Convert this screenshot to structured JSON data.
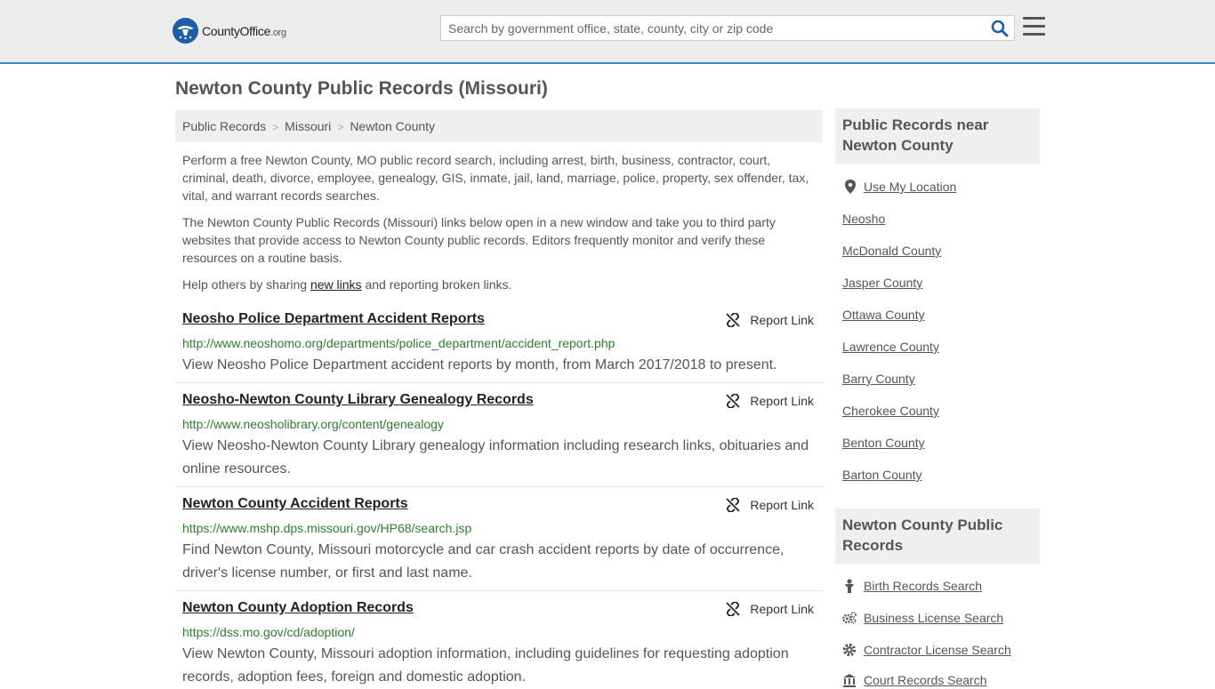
{
  "header": {
    "logo_text": "CountyOffice",
    "logo_suffix": ".org",
    "search_placeholder": "Search by government office, state, county, city or zip code"
  },
  "page_title": "Newton County Public Records (Missouri)",
  "breadcrumb": [
    "Public Records",
    "Missouri",
    "Newton County"
  ],
  "intro": {
    "p1": "Perform a free Newton County, MO public record search, including arrest, birth, business, contractor, court, criminal, death, divorce, employee, genealogy, GIS, inmate, jail, land, marriage, police, property, sex offender, tax, vital, and warrant records searches.",
    "p2": "The Newton County Public Records (Missouri) links below open in a new window and take you to third party websites that provide access to Newton County public records. Editors frequently monitor and verify these resources on a routine basis.",
    "p3_before": "Help others by sharing ",
    "p3_link": "new links",
    "p3_after": " and reporting broken links."
  },
  "report_link_label": "Report Link",
  "records": [
    {
      "title": "Neosho Police Department Accident Reports",
      "url": "http://www.neoshomo.org/departments/police_department/accident_report.php",
      "desc": "View Neosho Police Department accident reports by month, from March 2017/2018 to present."
    },
    {
      "title": "Neosho-Newton County Library Genealogy Records",
      "url": "http://www.neosholibrary.org/content/genealogy",
      "desc": "View Neosho-Newton County Library genealogy information including research links, obituaries and online resources."
    },
    {
      "title": "Newton County Accident Reports",
      "url": "https://www.mshp.dps.missouri.gov/HP68/search.jsp",
      "desc": "Find Newton County, Missouri motorcycle and car crash accident reports by date of occurrence, driver's license number, or first and last name."
    },
    {
      "title": "Newton County Adoption Records",
      "url": "https://dss.mo.gov/cd/adoption/",
      "desc": "View Newton County, Missouri adoption information, including guidelines for requesting adoption records, adoption fees, foreign and domestic adoption."
    }
  ],
  "sidebar": {
    "nearby_title": "Public Records near Newton County",
    "use_location": "Use My Location",
    "nearby": [
      "Neosho",
      "McDonald County",
      "Jasper County",
      "Ottawa County",
      "Lawrence County",
      "Barry County",
      "Cherokee County",
      "Benton County",
      "Barton County"
    ],
    "records_title": "Newton County Public Records",
    "record_links": [
      {
        "label": "Birth Records Search",
        "icon": "baby-icon"
      },
      {
        "label": "Business License Search",
        "icon": "gears-icon"
      },
      {
        "label": "Contractor License Search",
        "icon": "gear-icon"
      },
      {
        "label": "Court Records Search",
        "icon": "courthouse-icon"
      }
    ]
  },
  "colors": {
    "accent": "#3a86c8",
    "logo_blue": "#1d5da5",
    "url_green": "#2e7d32",
    "panel_gray": "#efefef"
  }
}
